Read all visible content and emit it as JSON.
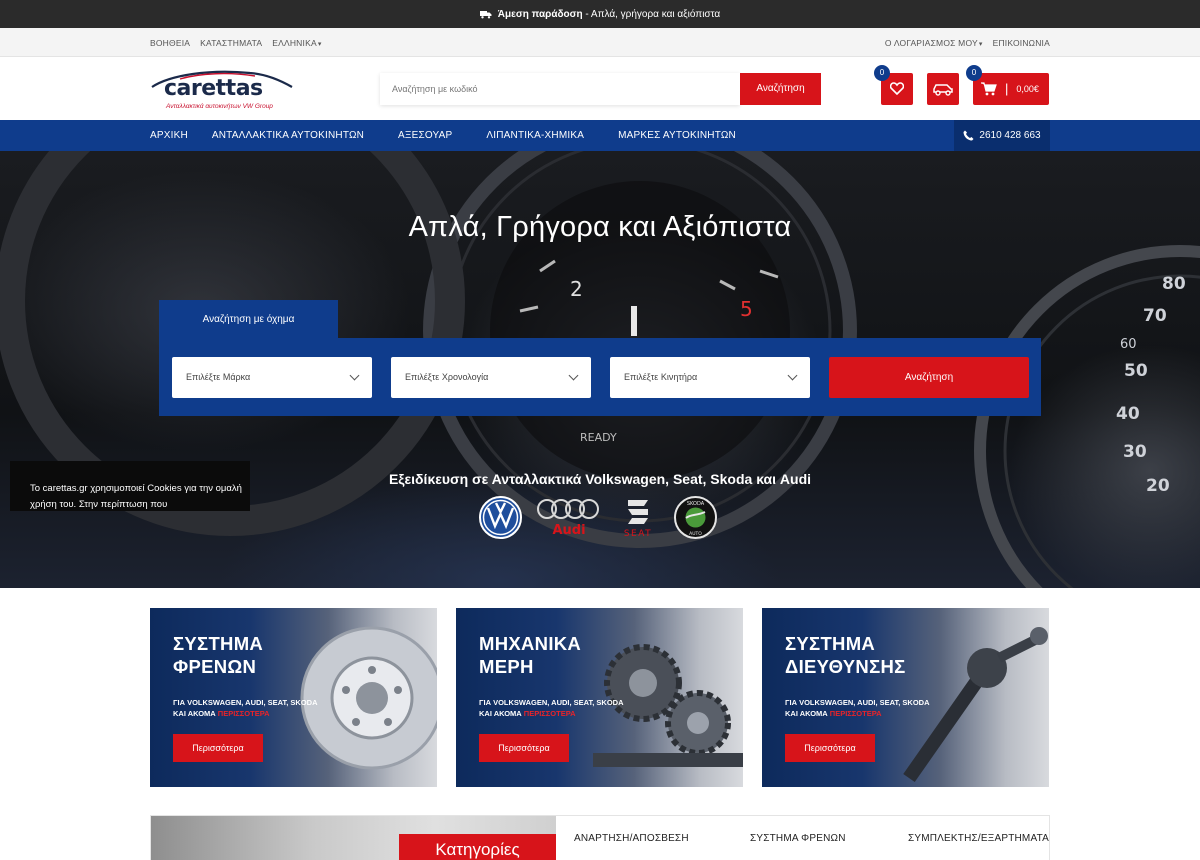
{
  "announcement": {
    "bold": "Άμεση παράδοση",
    "rest": " - Απλά, γρήγορα και αξιόπιστα"
  },
  "utility": {
    "left": [
      "ΒΟΗΘΕΙΑ",
      "ΚΑΤΑΣΤΗΜΑΤΑ",
      "ΕΛΛΗΝΙΚΑ"
    ],
    "right": [
      "Ο ΛΟΓΑΡΙΑΣΜΟΣ ΜΟΥ",
      "ΕΠΙΚΟΙΝΩΝΙΑ"
    ]
  },
  "logo": {
    "brand": "carettas",
    "tagline": "Ανταλλακτικά αυτοκινήτων VW Group"
  },
  "search": {
    "placeholder": "Αναζήτηση με κωδικό",
    "button": "Αναζήτηση"
  },
  "wishlist": {
    "count": "0"
  },
  "cart": {
    "count": "0",
    "total": "0,00€"
  },
  "nav": {
    "items": [
      "ΑΡΧΙΚΗ",
      "ΑΝΤΑΛΛΑΚΤΙΚΑ ΑΥΤΟΚΙΝΗΤΩΝ",
      "ΑΞΕΣΟΥΑΡ",
      "ΛΙΠΑΝΤΙΚΑ-ΧΗΜΙΚΑ",
      "ΜΑΡΚΕΣ ΑΥΤΟΚΙΝΗΤΩΝ"
    ],
    "phone": "2610 428 663"
  },
  "hero": {
    "title": "Απλά, Γρήγορα και Αξιόπιστα",
    "tab": "Αναζήτηση με όχημα",
    "selects": [
      "Επιλέξτε Μάρκα",
      "Επιλέξτε Χρονολογία",
      "Επιλέξτε Κινητήρα"
    ],
    "button": "Αναζήτηση",
    "specialization": "Εξειδίκευση σε Ανταλλακτικά Volkswagen, Seat, Skoda και Audi",
    "brand_logos": {
      "audi": "Audi",
      "seat": "SEAT",
      "skoda": "SKODA",
      "skoda_sub": "AUTO"
    }
  },
  "cookie": {
    "text": "Το carettas.gr χρησιμοποιεί Cookies για την ομαλή χρήση του. Στην περίπτωση που"
  },
  "promos": [
    {
      "title1": "ΣΥΣΤΗΜΑ",
      "title2": "ΦΡΕΝΩΝ",
      "sub1": "ΓΙΑ VOLKSWAGEN, AUDI, SEAT, SKODA",
      "sub2": "ΚΑΙ ΑΚΟΜΑ ",
      "sub_red": "ΠΕΡΙΣΣΟΤΕΡΑ",
      "button": "Περισσότερα"
    },
    {
      "title1": "ΜΗΧΑΝΙΚΑ",
      "title2": "ΜΕΡΗ",
      "sub1": "ΓΙΑ VOLKSWAGEN, AUDI, SEAT, SKODA",
      "sub2": "ΚΑΙ ΑΚΟΜΑ ",
      "sub_red": "ΠΕΡΙΣΣΟΤΕΡΑ",
      "button": "Περισσότερα"
    },
    {
      "title1": "ΣΥΣΤΗΜΑ",
      "title2": "ΔΙΕΥΘΥΝΣΗΣ",
      "sub1": "ΓΙΑ VOLKSWAGEN, AUDI, SEAT, SKODA",
      "sub2": "ΚΑΙ ΑΚΟΜΑ ",
      "sub_red": "ΠΕΡΙΣΣΟΤΕΡΑ",
      "button": "Περισσότερα"
    }
  ],
  "bottom": {
    "tab": "Κατηγορίες",
    "categories": [
      "ΑΝΑΡΤΗΣΗ/ΑΠΟΣΒΕΣΗ",
      "ΣΥΣΤΗΜΑ ΦΡΕΝΩΝ",
      "ΣΥΜΠΛΕΚΤΗΣ/ΕΞΑΡΤΗΜΑΤΑ"
    ]
  },
  "colors": {
    "brand_red": "#d7141a",
    "brand_blue": "#0f3c8c",
    "dark": "#2b2b2b"
  }
}
